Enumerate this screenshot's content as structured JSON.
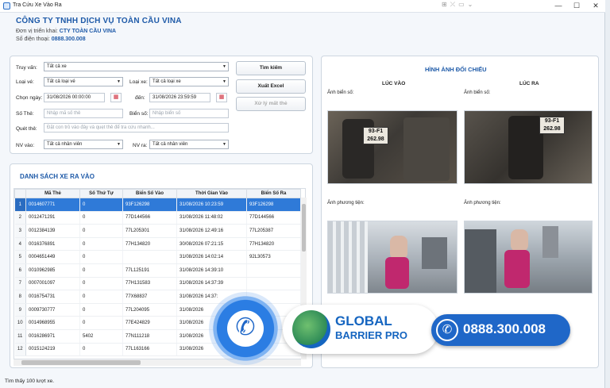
{
  "window": {
    "title": "Tra Cứu Xe Vào Ra",
    "min_label": "—",
    "max_label": "☐",
    "close_label": "✕"
  },
  "header": {
    "company": "CÔNG TY TNHH DỊCH VỤ TOÀN CẦU VINA",
    "unit_label": "Đơn vị triển khai:",
    "unit_value": "CTY TOÀN CẦU VINA",
    "phone_label": "Số điện thoại:",
    "phone_value": "0888.300.008"
  },
  "filters": {
    "truy_van_label": "Truy vấn:",
    "truy_van_value": "Tất cả xe",
    "loai_ve_label": "Loại vé:",
    "loai_ve_value": "Tất cả loại vé",
    "loai_xe_label": "Loại xe:",
    "loai_xe_value": "Tất cả loại xe",
    "chon_ngay_label": "Chọn ngày:",
    "from_date": "31/08/2026 00:00:00",
    "den_label": "đến:",
    "to_date": "31/08/2026 23:59:59",
    "so_the_label": "Số Thẻ:",
    "so_the_placeholder": "Nhập mã số thẻ",
    "bien_so_label": "Biển số:",
    "bien_so_placeholder": "Nhập biển số",
    "quet_the_label": "Quét thẻ:",
    "quet_the_placeholder": "Đặt con trỏ vào đây và quẹt thẻ để tra cứu nhanh...",
    "nv_vao_label": "NV vào:",
    "nv_vao_value": "Tất cả nhân viên",
    "nv_ra_label": "NV ra:",
    "nv_ra_value": "Tất cả nhân viên"
  },
  "actions": {
    "search": "Tìm kiếm",
    "export": "Xuất Excel",
    "lost_card": "Xử lý mất thẻ"
  },
  "list": {
    "title": "DANH SÁCH XE RA VÀO",
    "columns": [
      "Mã Thẻ",
      "Số Thứ Tự",
      "Biển Số Vào",
      "Thời Gian Vào",
      "Biển Số Ra"
    ],
    "rows": [
      {
        "n": "1",
        "ma": "0014607771",
        "stt": "0",
        "bsv": "93F126298",
        "tgv": "31/08/2026 10:23:59",
        "bsr": "93F126298"
      },
      {
        "n": "2",
        "ma": "0012471291",
        "stt": "0",
        "bsv": "77D144566",
        "tgv": "31/08/2026 11:48:02",
        "bsr": "77D144566"
      },
      {
        "n": "3",
        "ma": "0012384139",
        "stt": "0",
        "bsv": "77L205301",
        "tgv": "31/08/2026 12:49:16",
        "bsr": "77L205387"
      },
      {
        "n": "4",
        "ma": "0016376891",
        "stt": "0",
        "bsv": "77H134820",
        "tgv": "30/08/2026 07:21:15",
        "bsr": "77H134820"
      },
      {
        "n": "5",
        "ma": "0004651449",
        "stt": "0",
        "bsv": "",
        "tgv": "31/08/2026 14:02:14",
        "bsr": "92L30573"
      },
      {
        "n": "6",
        "ma": "0010962985",
        "stt": "0",
        "bsv": "77L125191",
        "tgv": "31/08/2026 14:39:10",
        "bsr": ""
      },
      {
        "n": "7",
        "ma": "0007001097",
        "stt": "0",
        "bsv": "77H131583",
        "tgv": "31/08/2026 14:37:39",
        "bsr": ""
      },
      {
        "n": "8",
        "ma": "0016754731",
        "stt": "0",
        "bsv": "77X68837",
        "tgv": "31/08/2026 14:37:",
        "bsr": ""
      },
      {
        "n": "9",
        "ma": "0009730777",
        "stt": "0",
        "bsv": "77L204095",
        "tgv": "31/08/2026",
        "bsr": ""
      },
      {
        "n": "10",
        "ma": "0014968955",
        "stt": "0",
        "bsv": "77E424829",
        "tgv": "31/08/2026",
        "bsr": ""
      },
      {
        "n": "11",
        "ma": "0016286971",
        "stt": "5402",
        "bsv": "77N111218",
        "tgv": "31/08/2026",
        "bsr": ""
      },
      {
        "n": "12",
        "ma": "0015124219",
        "stt": "0",
        "bsv": "77L163166",
        "tgv": "31/08/2026",
        "bsr": ""
      }
    ]
  },
  "images": {
    "title": "HÌNH ẢNH ĐỐI CHIẾU",
    "in_label": "LÚC VÀO",
    "out_label": "LÚC RA",
    "plate_label_in": "Ảnh biển số:",
    "plate_label_out": "Ảnh biển số:",
    "vehicle_label_in": "Ảnh phương tiện:",
    "vehicle_label_out": "Ảnh phương tiện:",
    "plate_in_top": "93-F1",
    "plate_in_bottom": "262.98",
    "plate_out_top": "93-F1",
    "plate_out_bottom": "262.98"
  },
  "status": "Tìm thấy 100 lượt xe.",
  "banner": {
    "brand_line1": "GLOBAL",
    "brand_line2": "BARRIER PRO",
    "phone": "0888.300.008"
  },
  "colors": {
    "accent": "#1e5aa8",
    "selection": "#2f7ad8",
    "brand_blue": "#1565c0",
    "brand_green": "#4caf50"
  }
}
